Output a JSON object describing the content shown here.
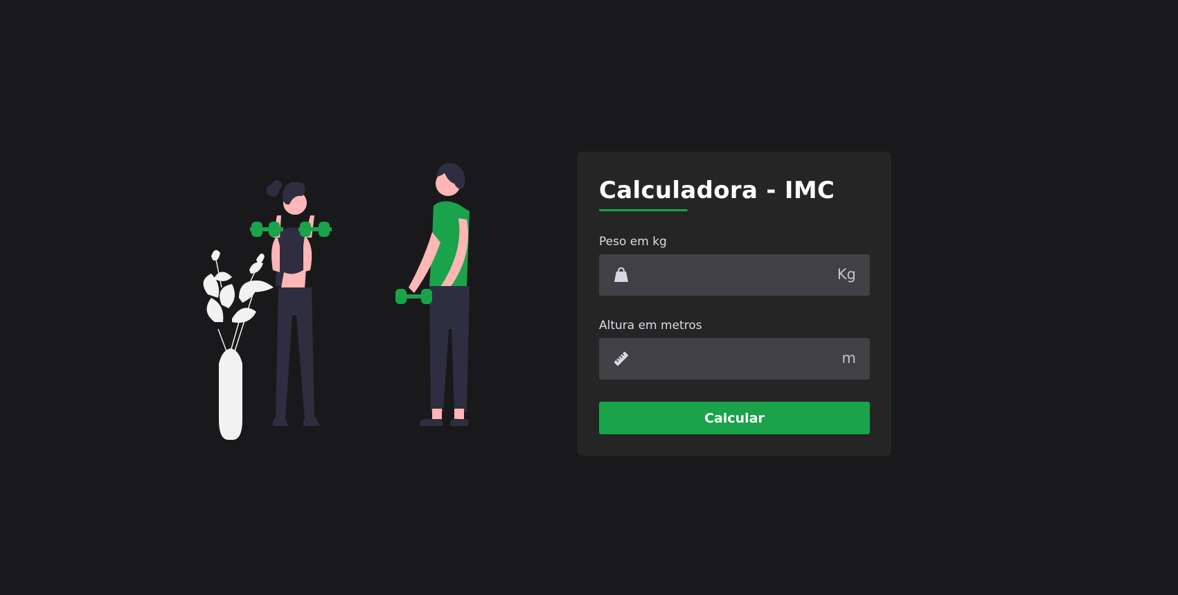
{
  "card": {
    "title": "Calculadora - IMC",
    "weight": {
      "label": "Peso em kg",
      "value": "",
      "placeholder": "",
      "unit": "Kg",
      "icon": "weight-icon"
    },
    "height": {
      "label": "Altura em metros",
      "value": "",
      "placeholder": "",
      "unit": "m",
      "icon": "ruler-icon"
    },
    "button_label": "Calcular"
  },
  "colors": {
    "background": "#19191b",
    "card": "#252526",
    "input": "#404045",
    "accent": "#1aa34a"
  }
}
